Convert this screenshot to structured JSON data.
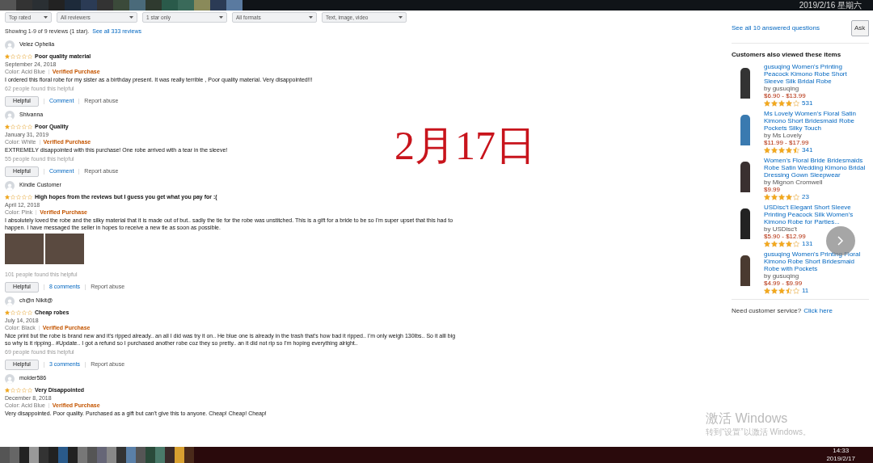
{
  "top_taskbar": {
    "date": "2019/2/16 星期六"
  },
  "filters": [
    {
      "label": "Top rated"
    },
    {
      "label": "All reviewers"
    },
    {
      "label": "1 star only"
    },
    {
      "label": "All formats"
    },
    {
      "label": "Text, image, video"
    }
  ],
  "summary": {
    "text": "Showing 1-9 of 9 reviews (1 star).",
    "link": "See all 333 reviews"
  },
  "reviews": [
    {
      "author": "Velez Ophelia",
      "stars": 1,
      "title": "Poor quality material",
      "date": "September 24, 2018",
      "variant": "Color: Acid Blue",
      "badge": "Verified Purchase",
      "body": "I ordered this floral robe for my sister as a birthday present. It was really terrible , Poor quality material. Very disappointed!!!",
      "helpful_count": "62 people found this helpful",
      "helpful_button": "Helpful",
      "comments": "Comment",
      "report": "Report abuse"
    },
    {
      "author": "Shivanna",
      "stars": 1,
      "title": "Poor Quality",
      "date": "January 31, 2019",
      "variant": "Color: White",
      "badge": "Verified Purchase",
      "body": "EXTREMELY disappointed with this purchase! One robe arrived with a tear in the sleeve!",
      "helpful_count": "55 people found this helpful",
      "helpful_button": "Helpful",
      "comments": "Comment",
      "report": "Report abuse"
    },
    {
      "author": "Kindle Customer",
      "stars": 1,
      "title": "High hopes from the reviews but I guess you get what you pay for :(",
      "date": "April 12, 2018",
      "variant": "Color: Pink",
      "badge": "Verified Purchase",
      "body": "I absolutely loved the robe and the silky material that it is made out of but.. sadly the tie for the robe was unstitched. This is a gift for a bride to be so I'm super upset that this had to happen. I have messaged the seller in hopes to receive a new tie as soon as possible.",
      "photos": [
        {
          "kind": "photo"
        },
        {
          "kind": "photo"
        }
      ],
      "helpful_count": "101 people found this helpful",
      "helpful_button": "Helpful",
      "comments": "8 comments",
      "report": "Report abuse"
    },
    {
      "author": "ch@n Nikit@",
      "stars": 1,
      "title": "Cheap robes",
      "date": "July 14, 2018",
      "variant": "Color: Black",
      "badge": "Verified Purchase",
      "body": "Nice print but the robe is brand new and it's ripped already.. an all I did was try it on.. He blue one is already in the trash that's how bad it ripped.. I'm only weigh 130lbs.. So it alll big so why is it ripping.. #Update.. I got a refund so I purchased another robe coz they so pretty.. an it did not rip so I'm hoping everything alright..",
      "helpful_count": "69 people found this helpful",
      "helpful_button": "Helpful",
      "comments": "3 comments",
      "report": "Report abuse"
    },
    {
      "author": "molder586",
      "stars": 1,
      "title": "Very Disappointed",
      "date": "December 8, 2018",
      "variant": "Color: Acid Blue",
      "badge": "Verified Purchase",
      "body": "Very disappointed. Poor quality. Purchased as a gift but can't give this to anyone. Cheap! Cheap! Cheap!"
    }
  ],
  "sidebar": {
    "questions_link": "See all 10 answered questions",
    "ask_button": "Ask",
    "heading": "Customers also viewed these items",
    "items": [
      {
        "title": "gusuqing Women's Printing Peacock Kimono Robe Short Sleeve Silk Bridal Robe",
        "by": "by gusuqing",
        "price": "$6.90 - $13.99",
        "stars": 4,
        "count": "531"
      },
      {
        "title": "Ms Lovely Women's Floral Satin Kimono Short Bridesmaid Robe Pockets Silky Touch",
        "by": "by Ms Lovely",
        "price": "$11.99 - $17.99",
        "stars": 4.5,
        "count": "341"
      },
      {
        "title": "Women's Floral Bride Bridesmaids Robe Satin Wedding Kimono Bridal Dressing Gown Sleepwear",
        "by": "by Mignon Cromwell",
        "price": "$9.99",
        "stars": 4,
        "count": "23"
      },
      {
        "title": "USDisc't Elegant Short Sleeve Printing Peacock Silk Women's Kimono Robe for Parties...",
        "by": "by USDisc't",
        "price": "$5.90 - $12.99",
        "stars": 4,
        "count": "131"
      },
      {
        "title": "gusuqing Women's Printing Floral Kimono Robe Short Bridesmaid Robe with Pockets",
        "by": "by gusuqing",
        "price": "$4.99 - $9.99",
        "stars": 3.5,
        "count": "11"
      }
    ],
    "service_text": "Need customer service?",
    "service_link": "Click here"
  },
  "overlay_date": "2月17日",
  "activation": {
    "title": "激活 Windows",
    "subtitle": "转到“设置”以激活 Windows。"
  },
  "bottom_taskbar": {
    "time": "14:33",
    "date": "2019/2/17"
  }
}
